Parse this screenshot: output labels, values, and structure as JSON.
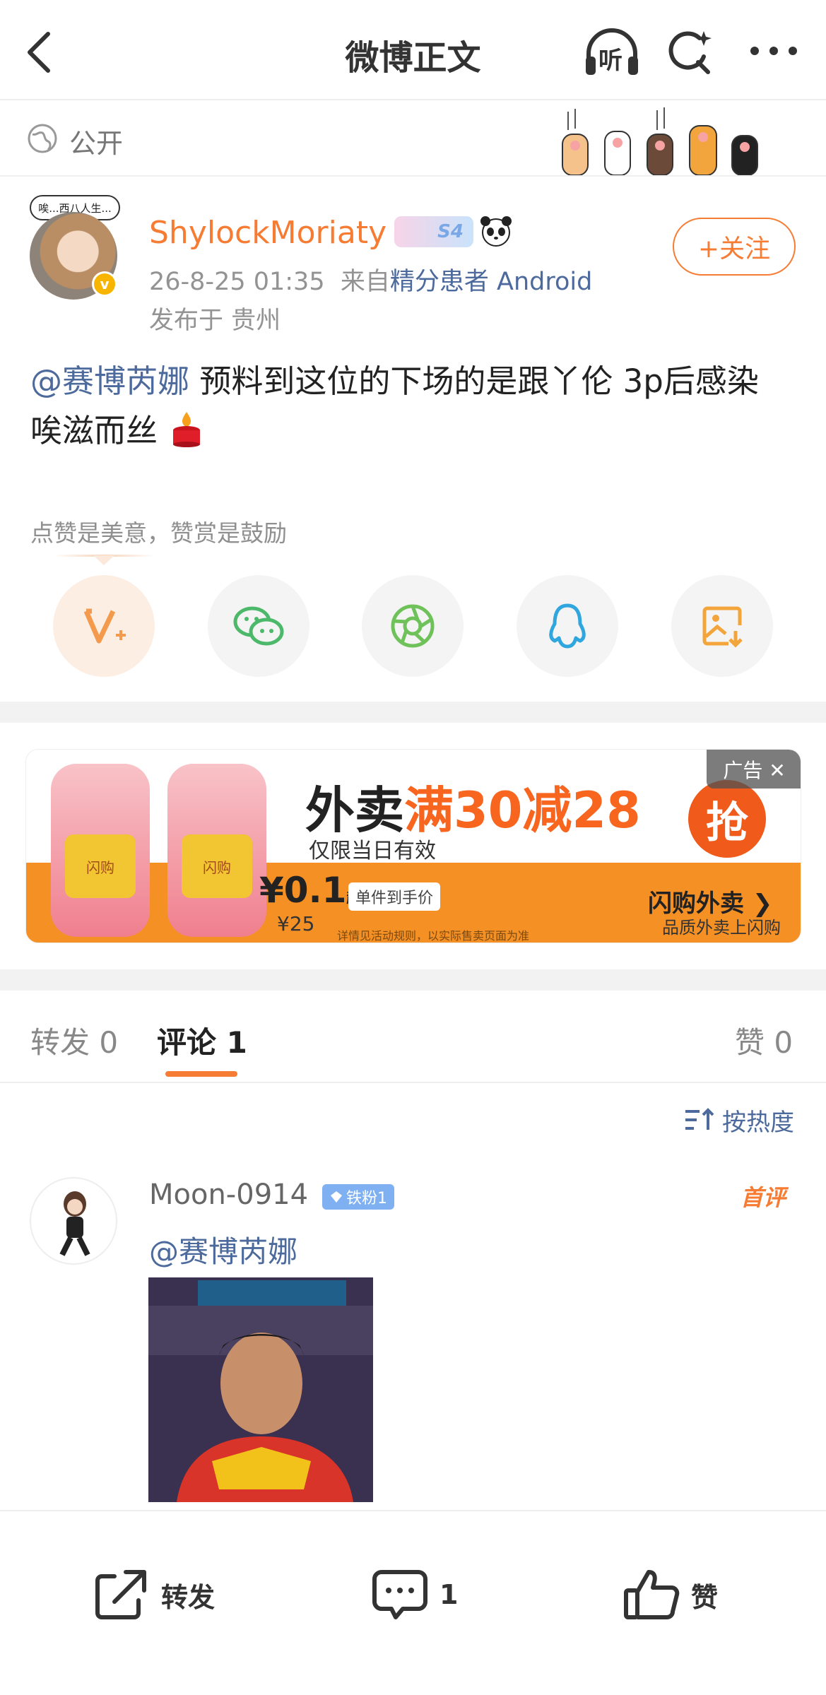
{
  "header": {
    "title": "微博正文",
    "listen_label": "听"
  },
  "visibility": {
    "label": "公开"
  },
  "post": {
    "avatar_speech": "唉...西八人生...",
    "author": "ShylockMoriaty",
    "level_badge": "S4",
    "time": "26-8-25 01:35",
    "source_prefix": "来自",
    "source": "精分患者 Android",
    "location": "发布于 贵州",
    "follow_label": "+关注",
    "mention": "@赛博芮娜",
    "text_line1": " 预料到这位的下场的是跟丫伦 3p后感染",
    "text_line2": "唉滋而丝"
  },
  "reward": {
    "hint": "点赞是美意，赞赏是鼓励",
    "share_targets": [
      "reward",
      "wechat",
      "moments",
      "qq",
      "save-image"
    ]
  },
  "ad": {
    "headline_a": "外卖",
    "headline_b": "满30减28",
    "subline": "仅限当日有效",
    "grab_label": "抢",
    "tag": "广告 ✕",
    "price": "¥0.1",
    "price_suffix": "起",
    "price_note": "单件到手价",
    "original_price": "¥25",
    "rules": "详情见活动规则，以实际售卖页面为准",
    "brand": "闪购外卖 ❯",
    "brand_sub": "品质外卖上闪购",
    "cup_label": "闪购"
  },
  "tabs": {
    "repost": "转发",
    "repost_count": "0",
    "comment": "评论",
    "comment_count": "1",
    "like": "赞",
    "like_count": "0"
  },
  "sort": {
    "label": "按热度"
  },
  "comment": {
    "user": "Moon-0914",
    "fan_badge": "铁粉1",
    "first_tag": "首评",
    "mention": "@赛博芮娜"
  },
  "bottombar": {
    "repost": "转发",
    "comment_count": "1",
    "like": "赞"
  },
  "colors": {
    "accent": "#f77c33",
    "link": "#4d6a9c"
  }
}
